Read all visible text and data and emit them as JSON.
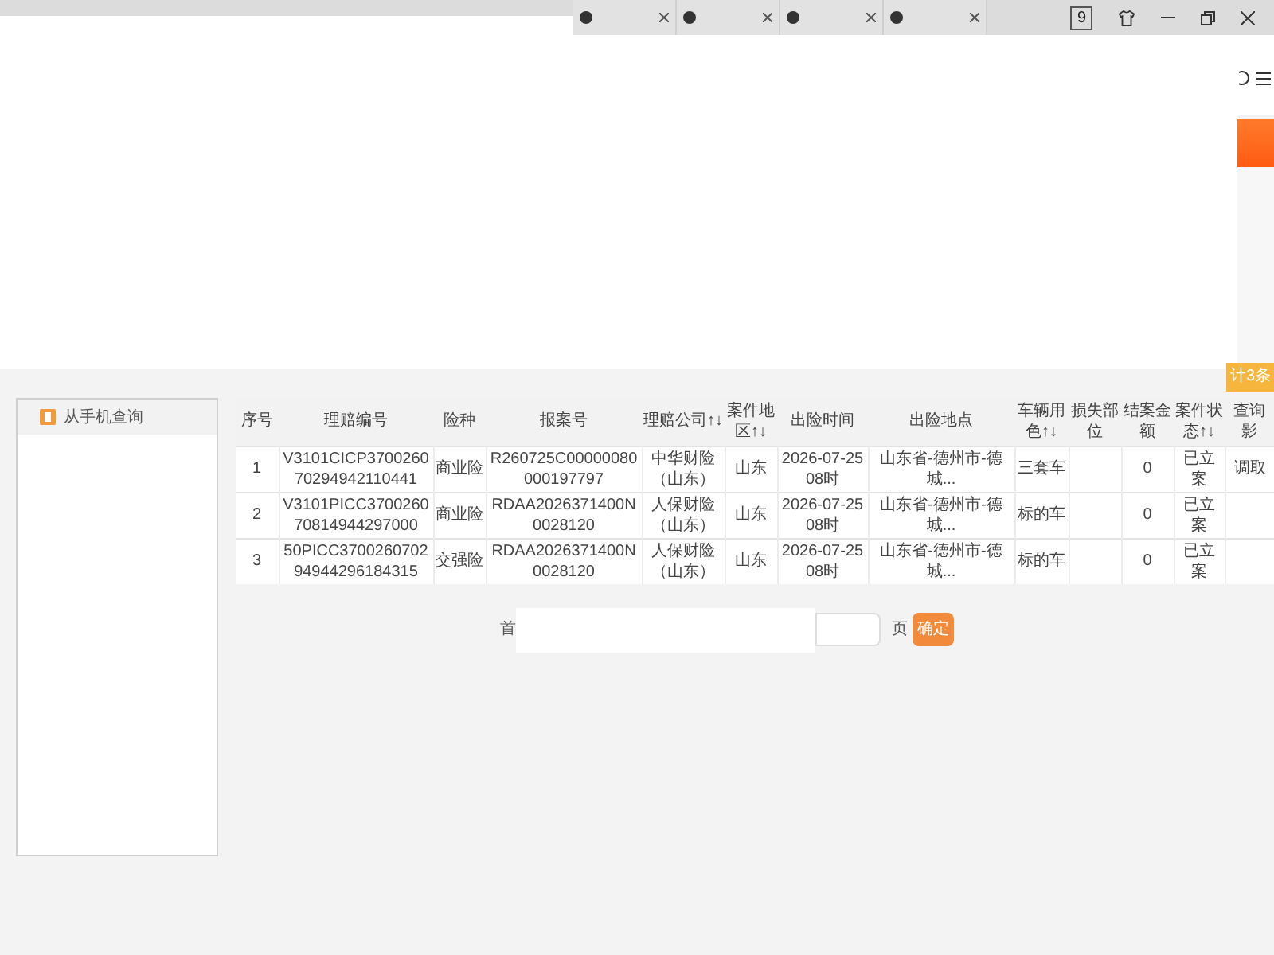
{
  "browser": {
    "tab_badge": "9"
  },
  "result_count": "计3条",
  "sidebar": {
    "items": [
      {
        "label": "从手机查询"
      }
    ]
  },
  "table": {
    "columns": [
      "序号",
      "理赔编号",
      "险种",
      "报案号",
      "理赔公司↑↓",
      "案件地区↑↓",
      "出险时间",
      "出险地点",
      "车辆用色↑↓",
      "损失部位",
      "结案金额",
      "案件状态↑↓",
      "查询影"
    ],
    "rows": [
      {
        "cells": [
          "1",
          "V3101CICP370026070294942110441",
          "商业险",
          "R260725C00000080000197797",
          "中华财险（山东）",
          "山东",
          "2026-07-25 08时",
          "山东省-德州市-德城...",
          "三套车",
          "",
          "0",
          "已立案"
        ],
        "action": "调取"
      },
      {
        "cells": [
          "2",
          "V3101PICC370026070814944297000",
          "商业险",
          "RDAA2026371400N0028120",
          "人保财险（山东）",
          "山东",
          "2026-07-25 08时",
          "山东省-德州市-德城...",
          "标的车",
          "",
          "0",
          "已立案"
        ]
      },
      {
        "cells": [
          "3",
          "50PICC370026070294944296184315",
          "交强险",
          "RDAA2026371400N0028120",
          "人保财险（山东）",
          "山东",
          "2026-07-25 08时",
          "山东省-德州市-德城...",
          "标的车",
          "",
          "0",
          "已立案"
        ]
      }
    ]
  },
  "pagination": {
    "first": "首",
    "page_suffix": "页",
    "confirm": "确定"
  }
}
